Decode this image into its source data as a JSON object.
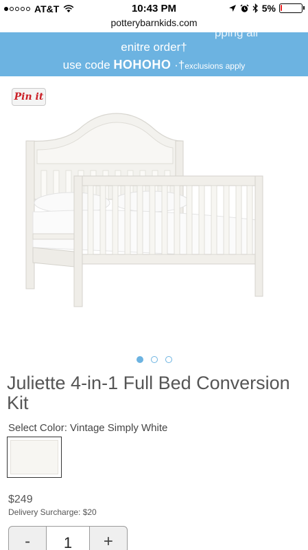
{
  "status_bar": {
    "carrier": "AT&T",
    "time": "10:43 PM",
    "battery": "5%",
    "battery_level": 0.05,
    "signal_bars_filled": 1,
    "signal_bars_total": 5
  },
  "browser": {
    "url": "potterybarnkids.com"
  },
  "promo": {
    "partial_line": "pping all",
    "line1": "enitre order†",
    "line2_prefix": "use code ",
    "code": "HOHOHO",
    "line2_suffix": " ·†",
    "exclusions": "exclusions apply",
    "background_color": "#6cb3e1"
  },
  "pin_button": {
    "label": "Pin it",
    "color": "#cb2027"
  },
  "carousel": {
    "total": 3,
    "active": 0,
    "color": "#6cb3e1"
  },
  "product": {
    "title": "Juliette 4-in-1 Full Bed Conversion Kit",
    "select_color_label": "Select Color: Vintage Simply White",
    "price": "$249",
    "surcharge": "Delivery Surcharge: $20"
  },
  "quantity": {
    "minus": "-",
    "value": "1",
    "plus": "+"
  }
}
